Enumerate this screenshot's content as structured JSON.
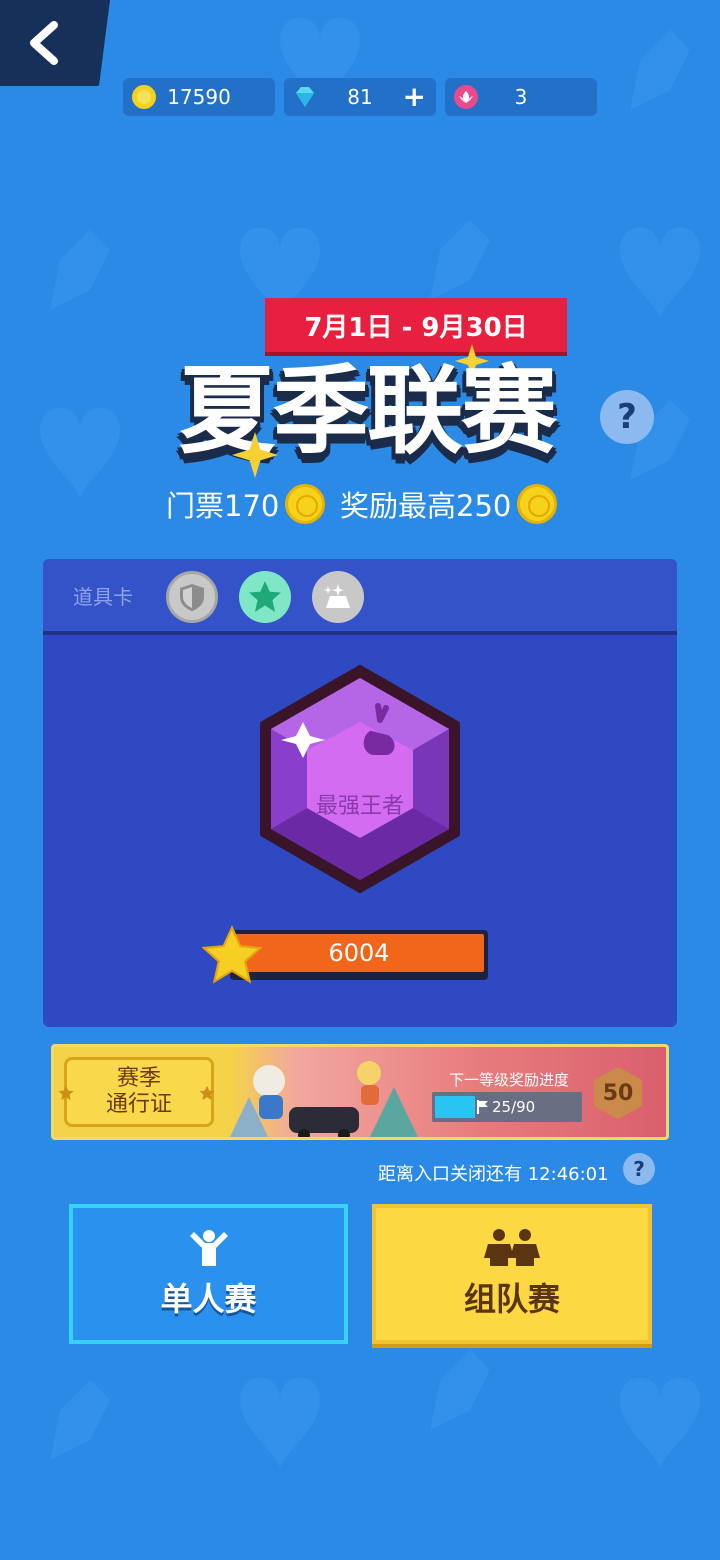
{
  "currency": {
    "coins": "17590",
    "gems": "81",
    "gems_add": "+",
    "tokens": "3"
  },
  "event": {
    "date_range": "7月1日 - 9月30日",
    "title": "夏季联赛",
    "help": "?",
    "ticket_label": "门票170",
    "reward_label": "奖励最高250"
  },
  "items": {
    "label": "道具卡",
    "icons": [
      "shield-icon",
      "star-icon",
      "sparkle-icon"
    ]
  },
  "rank": {
    "name": "最强王者",
    "score": "6004"
  },
  "pass": {
    "title_line1": "赛季",
    "title_line2": "通行证",
    "progress_label": "下一等级奖励进度",
    "progress_text": "25/90",
    "progress": 0.2778,
    "level": "50"
  },
  "countdown": {
    "text": "距离入口关闭还有 12:46:01",
    "help": "?"
  },
  "modes": {
    "single": "单人赛",
    "team": "组队赛"
  },
  "colors": {
    "background": "#2a8ae6",
    "panel": "#2e49c2",
    "banner_red": "#e8203f",
    "score_orange": "#f2661c",
    "team_yellow": "#fcd842",
    "single_blue": "#2a91ee"
  }
}
